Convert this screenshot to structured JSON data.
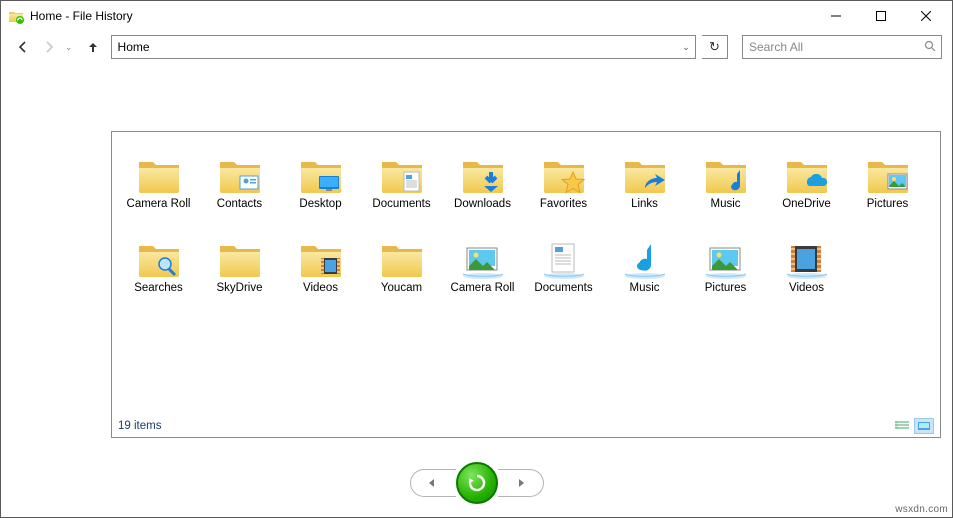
{
  "window": {
    "title": "Home - File History"
  },
  "nav": {
    "location": "Home",
    "search_placeholder": "Search All"
  },
  "items": [
    {
      "label": "Camera Roll",
      "kind": "folder"
    },
    {
      "label": "Contacts",
      "kind": "folder-overlay",
      "overlay": "contact"
    },
    {
      "label": "Desktop",
      "kind": "folder-overlay",
      "overlay": "desktop"
    },
    {
      "label": "Documents",
      "kind": "folder-overlay",
      "overlay": "doc"
    },
    {
      "label": "Downloads",
      "kind": "folder-overlay",
      "overlay": "download"
    },
    {
      "label": "Favorites",
      "kind": "folder-overlay",
      "overlay": "star"
    },
    {
      "label": "Links",
      "kind": "folder-overlay",
      "overlay": "link"
    },
    {
      "label": "Music",
      "kind": "folder-overlay",
      "overlay": "music"
    },
    {
      "label": "OneDrive",
      "kind": "folder-overlay",
      "overlay": "cloud"
    },
    {
      "label": "Pictures",
      "kind": "folder-overlay",
      "overlay": "picture"
    },
    {
      "label": "Searches",
      "kind": "folder-overlay",
      "overlay": "search"
    },
    {
      "label": "SkyDrive",
      "kind": "folder"
    },
    {
      "label": "Videos",
      "kind": "folder-overlay",
      "overlay": "video"
    },
    {
      "label": "Youcam",
      "kind": "folder"
    },
    {
      "label": "Camera Roll",
      "kind": "lib-pictures"
    },
    {
      "label": "Documents",
      "kind": "lib-doc"
    },
    {
      "label": "Music",
      "kind": "lib-music"
    },
    {
      "label": "Pictures",
      "kind": "lib-pictures"
    },
    {
      "label": "Videos",
      "kind": "lib-video"
    }
  ],
  "status": {
    "count_text": "19 items"
  },
  "watermark": "wsxdn.com"
}
